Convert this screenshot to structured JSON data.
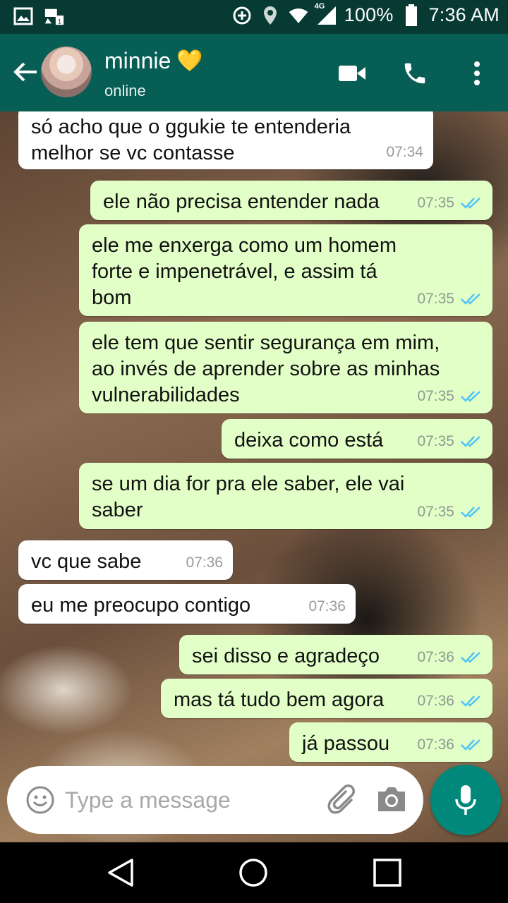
{
  "status_bar": {
    "battery": "100%",
    "time": "7:36 AM",
    "network": "4G",
    "icons": [
      "image-icon",
      "sim-icon",
      "data-saver-icon",
      "location-icon",
      "wifi-icon",
      "signal-icon",
      "battery-icon"
    ]
  },
  "header": {
    "contact_name": "minnie",
    "name_emoji": "💛",
    "status": "online",
    "icons": [
      "back-arrow-icon",
      "avatar",
      "video-call-icon",
      "phone-icon",
      "more-vert-icon"
    ]
  },
  "messages": [
    {
      "direction": "in",
      "text": "só acho que o ggukie te entenderia\nmelhor se vc contasse",
      "time": "07:34"
    },
    {
      "direction": "out",
      "text": "ele não precisa entender nada",
      "time": "07:35",
      "read": true
    },
    {
      "direction": "out",
      "text": "ele me enxerga como um homem\nforte e impenetrável, e assim tá\nbom",
      "time": "07:35",
      "read": true
    },
    {
      "direction": "out",
      "text": "ele tem que sentir segurança em mim,\nao invés de aprender sobre as minhas\nvulnerabilidades",
      "time": "07:35",
      "read": true
    },
    {
      "direction": "out",
      "text": "deixa como está",
      "time": "07:35",
      "read": true
    },
    {
      "direction": "out",
      "text": "se um dia for pra ele saber, ele vai\nsaber",
      "time": "07:35",
      "read": true
    },
    {
      "direction": "in",
      "text": "vc que sabe",
      "time": "07:36"
    },
    {
      "direction": "in",
      "text": "eu me preocupo contigo",
      "time": "07:36"
    },
    {
      "direction": "out",
      "text": "sei disso e agradeço",
      "time": "07:36",
      "read": true
    },
    {
      "direction": "out",
      "text": "mas tá tudo bem agora",
      "time": "07:36",
      "read": true
    },
    {
      "direction": "out",
      "text": "já passou",
      "time": "07:36",
      "read": true
    }
  ],
  "input": {
    "placeholder": "Type a message"
  },
  "colors": {
    "status_bar": "#063a33",
    "header": "#075e54",
    "outgoing_bubble": "#e2ffc7",
    "incoming_bubble": "#ffffff",
    "read_ticks": "#4fc3f7",
    "mic_button": "#00897b"
  }
}
